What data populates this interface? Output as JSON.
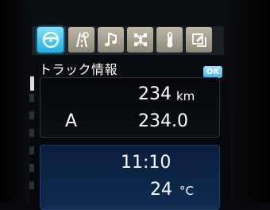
{
  "tabs": [
    {
      "icon": "steering-wheel-icon",
      "active": true
    },
    {
      "icon": "road-navigation-icon",
      "active": false
    },
    {
      "icon": "music-note-icon",
      "active": false
    },
    {
      "icon": "vehicle-chassis-icon",
      "active": false
    },
    {
      "icon": "thermometer-icon",
      "active": false
    },
    {
      "icon": "settings-edit-icon",
      "active": false
    }
  ],
  "title": "トラック情報",
  "ok_label": "OK",
  "trip": {
    "distance_value": "234",
    "distance_unit": "km",
    "trip_label": "A",
    "trip_value": "234.0"
  },
  "status": {
    "time": "11:10",
    "temp_value": "24",
    "temp_unit": "°C"
  },
  "colors": {
    "accent_tab": "#29c4ff",
    "inactive_tab": "#bfb7a6",
    "panel_blue": "#0f2a50"
  }
}
